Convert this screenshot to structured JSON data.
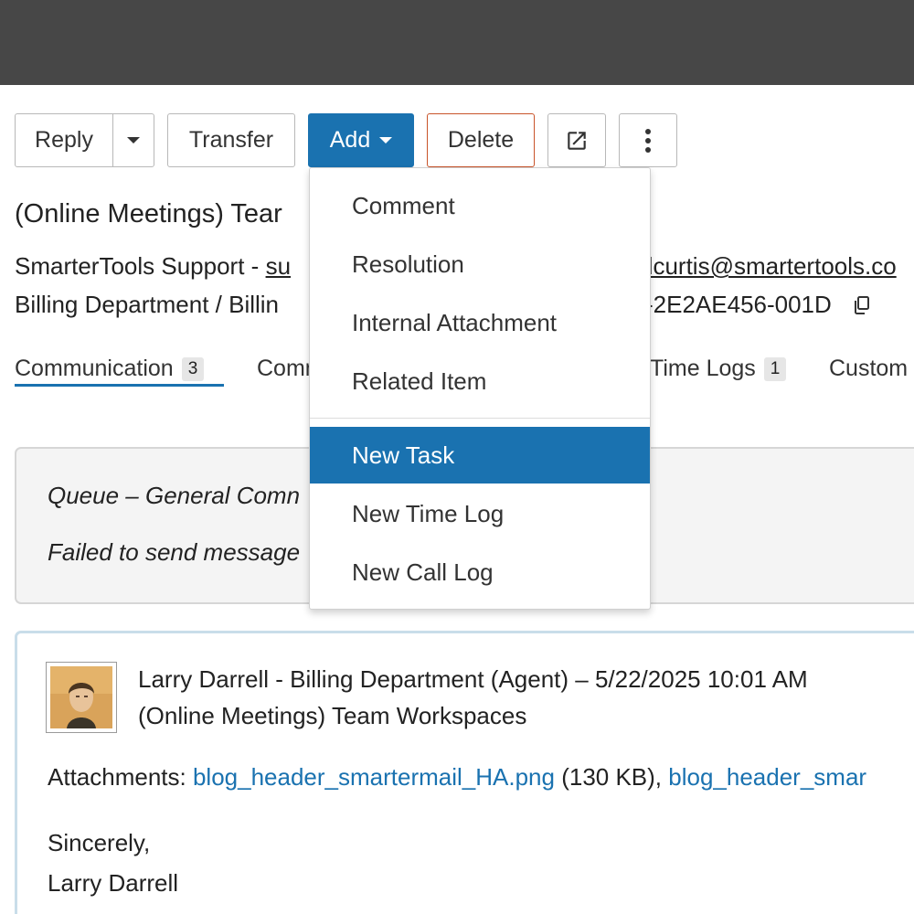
{
  "toolbar": {
    "reply_label": "Reply",
    "transfer_label": "Transfer",
    "add_label": "Add",
    "delete_label": "Delete"
  },
  "add_menu": {
    "items": [
      "Comment",
      "Resolution",
      "Internal Attachment",
      "Related Item"
    ],
    "items2": [
      "New Task",
      "New Time Log",
      "New Call Log"
    ],
    "selected": "New Task"
  },
  "ticket": {
    "title": "(Online Meetings) Tear",
    "line1_prefix": "SmarterTools Support - ",
    "line1_link": "su",
    "email_right": "dcurtis@smartertools.co",
    "line2_dept": "Billing Department",
    "line2_sep": "  / Billin",
    "ticket_id_part": "-2E2AE456-001D"
  },
  "tabs": {
    "communication": {
      "label": "Communication",
      "count": "3"
    },
    "comm2": {
      "label": "Comm"
    },
    "timelogs": {
      "label": "Time Logs",
      "count": "1"
    },
    "custom": {
      "label": "Custom"
    }
  },
  "system_note": {
    "queue_text": "Queue – General Comn",
    "failed_text": "Failed to send message"
  },
  "message": {
    "from": "Larry Darrell - Billing Department (Agent) – 5/22/2025 10:01 AM",
    "subject": "(Online Meetings) Team Workspaces",
    "attachments_label": "Attachments: ",
    "attachment1": "blog_header_smartermail_HA.png",
    "attachment1_size": " (130 KB), ",
    "attachment2": "blog_header_smar",
    "sig_closing": "Sincerely,",
    "sig_name": "Larry Darrell"
  },
  "colors": {
    "accent": "#1a72b0",
    "delete_border": "#c9542a",
    "topbar": "#474747"
  }
}
